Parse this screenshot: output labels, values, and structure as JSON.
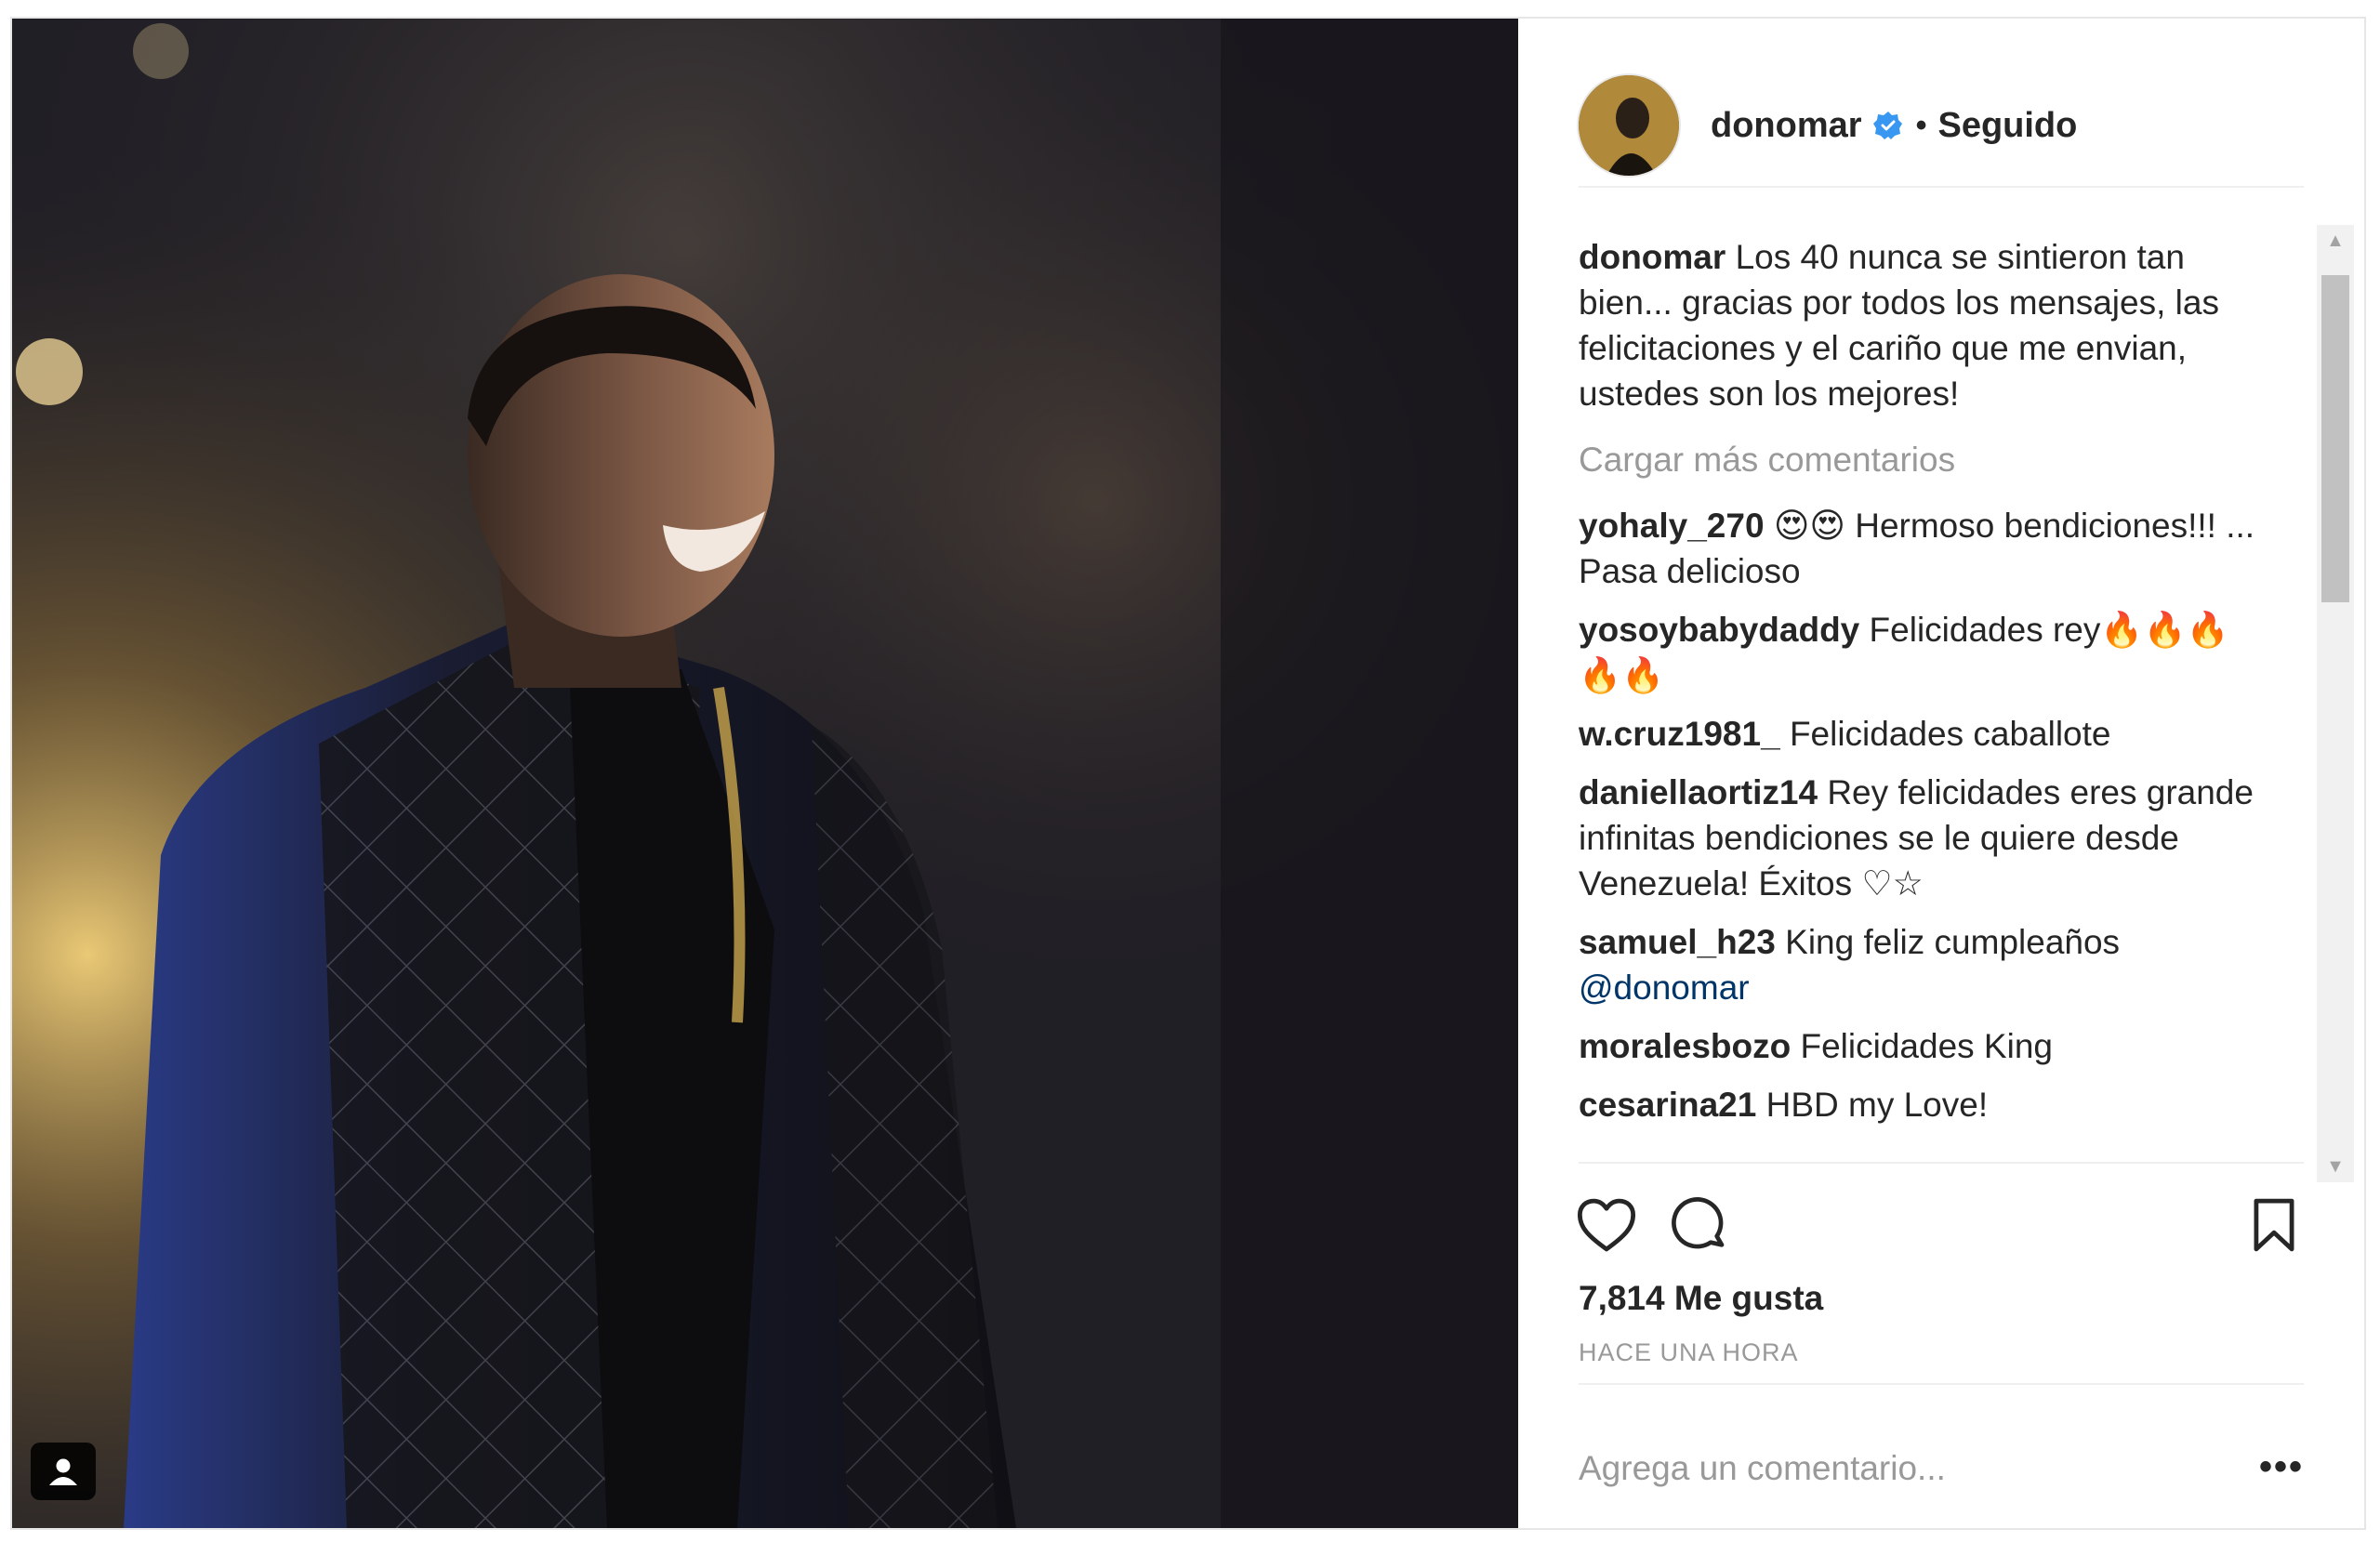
{
  "post": {
    "username": "donomar",
    "verified": true,
    "follow_separator": "•",
    "follow_status": "Seguido",
    "caption_user": "donomar",
    "caption_text": "Los 40 nunca se sintieron tan bien... gracias por todos los mensajes, las felicitaciones y el cariño que me envian, ustedes son los mejores!",
    "load_more": "Cargar más comentarios",
    "comments": [
      {
        "user": "yohaly_270",
        "text": "😍😍 Hermoso bendiciones!!! ... Pasa delicioso"
      },
      {
        "user": "yosoybabydaddy",
        "text": "Felicidades rey🔥🔥🔥🔥🔥"
      },
      {
        "user": "w.cruz1981_",
        "text": "Felicidades caballote"
      },
      {
        "user": "daniellaortiz14",
        "text": "Rey felicidades eres grande infinitas bendiciones se le quiere desde Venezuela! Éxitos ♡☆"
      },
      {
        "user": "samuel_h23",
        "text": "King feliz cumpleaños",
        "mention": "@donomar"
      },
      {
        "user": "moralesbozo",
        "text": "Felicidades King"
      },
      {
        "user": "cesarina21",
        "text": "HBD my Love!"
      }
    ],
    "likes": "7,814 Me gusta",
    "timestamp": "HACE UNA HORA",
    "add_comment_placeholder": "Agrega un comentario...",
    "more_options": "•••"
  },
  "icons": {
    "like": "heart-icon",
    "comment": "comment-bubble-icon",
    "save": "bookmark-icon",
    "verified": "verified-badge-icon",
    "tag": "user-tag-icon"
  },
  "colors": {
    "verified_blue": "#3897f0",
    "text": "#262626",
    "muted": "#999999",
    "mention": "#003569"
  }
}
